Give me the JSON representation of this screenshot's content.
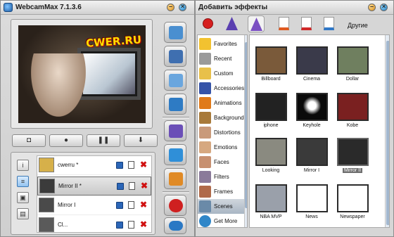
{
  "left_window": {
    "title": "WebcamMax  7.1.3.6",
    "minimize_glyph": "–",
    "close_glyph": "×"
  },
  "preview": {
    "overlay_text": "CWER.RU"
  },
  "controls": [
    {
      "icon": "camera-icon",
      "glyph": "◘"
    },
    {
      "icon": "record-icon",
      "glyph": "●"
    },
    {
      "icon": "pause-icon",
      "glyph": "❚❚"
    },
    {
      "icon": "download-icon",
      "glyph": "⬇"
    }
  ],
  "layer_side_buttons": [
    {
      "icon": "info-icon",
      "glyph": "i"
    },
    {
      "icon": "list-icon",
      "glyph": "≡"
    },
    {
      "icon": "person-icon",
      "glyph": "▣"
    },
    {
      "icon": "film-icon",
      "glyph": "▤"
    }
  ],
  "layers": [
    {
      "name": "cwerru *",
      "selected": false,
      "thumb_color": "#d6b04a"
    },
    {
      "name": "Mirror II *",
      "selected": true,
      "thumb_color": "#3b3b3b"
    },
    {
      "name": "Mirror I",
      "selected": false,
      "thumb_color": "#4a4a4a"
    },
    {
      "name": "Cl...",
      "selected": false,
      "thumb_color": "#5a5a5a"
    }
  ],
  "tools": [
    {
      "icon": "user-profile-icon",
      "color": "#4a8fd0"
    },
    {
      "icon": "video-clip-icon",
      "color": "#3f6fb0"
    },
    {
      "icon": "window-icon",
      "color": "#6aa6de"
    },
    {
      "icon": "screen-capture-icon",
      "color": "#2e7bc4"
    },
    {
      "icon": "wizard-hat-icon",
      "color": "#6b4fb7"
    },
    {
      "icon": "pencil-icon",
      "color": "#2f8fd8"
    },
    {
      "icon": "blocks-icon",
      "color": "#e08a25"
    },
    {
      "icon": "close-icon",
      "color": "#cf2020"
    },
    {
      "icon": "settings-icon",
      "color": "#2a78c4"
    }
  ],
  "right_window": {
    "title": "Добавить эффекты",
    "minimize_glyph": "–",
    "close_glyph": "×",
    "others_label": "Другие"
  },
  "category_tools": [
    {
      "icon": "remove-icon",
      "color": "#d61f1f",
      "selected": false
    },
    {
      "icon": "wizard-hat-icon",
      "color": "#5a3fb0",
      "selected": false
    },
    {
      "icon": "wizard-hat-plus-icon",
      "color": "#7a4fc2",
      "selected": true
    },
    {
      "icon": "add-image-icon",
      "color": "#e05a20",
      "selected": false
    },
    {
      "icon": "add-pdf-icon",
      "color": "#d02828",
      "selected": false
    },
    {
      "icon": "add-text-icon",
      "color": "#2f78c8",
      "selected": false
    }
  ],
  "categories": [
    {
      "label": "Favorites",
      "icon": "star-icon",
      "color": "#f2c230",
      "selected": false
    },
    {
      "label": "Recent",
      "icon": "clock-icon",
      "color": "#9a9a9a",
      "selected": false
    },
    {
      "label": "Custom",
      "icon": "folder-icon",
      "color": "#e8c04a",
      "selected": false
    },
    {
      "label": "Accessories",
      "icon": "cap-icon",
      "color": "#3553a8",
      "selected": false
    },
    {
      "label": "Animations",
      "icon": "butterfly-icon",
      "color": "#e07a1a",
      "selected": false
    },
    {
      "label": "Background",
      "icon": "landscape-icon",
      "color": "#a87a3a",
      "selected": false
    },
    {
      "label": "Distortions",
      "icon": "face-distort-icon",
      "color": "#c99a7a",
      "selected": false
    },
    {
      "label": "Emotions",
      "icon": "face-icon",
      "color": "#d6a880",
      "selected": false
    },
    {
      "label": "Faces",
      "icon": "face-mask-icon",
      "color": "#c79070",
      "selected": false
    },
    {
      "label": "Filters",
      "icon": "filter-icon",
      "color": "#8a7a9a",
      "selected": false
    },
    {
      "label": "Frames",
      "icon": "frame-icon",
      "color": "#b06a4a",
      "selected": false
    },
    {
      "label": "Scenes",
      "icon": "scene-icon",
      "color": "#6a8aa8",
      "selected": true
    },
    {
      "label": "Get More",
      "icon": "globe-icon",
      "color": "#2f86c8",
      "selected": false
    }
  ],
  "effects": [
    {
      "name": "Billboard",
      "selected": false,
      "thumb_color": "#7a5a3a"
    },
    {
      "name": "Cinema",
      "selected": false,
      "thumb_color": "#3a3a4a"
    },
    {
      "name": "Dollar",
      "selected": false,
      "thumb_color": "#6f7f5f"
    },
    {
      "name": "iphone",
      "selected": false,
      "thumb_color": "#222222"
    },
    {
      "name": "Keyhole",
      "selected": false,
      "thumb_color": "#0a0a0a"
    },
    {
      "name": "Kobe",
      "selected": false,
      "thumb_color": "#7a2020"
    },
    {
      "name": "Looking",
      "selected": false,
      "thumb_color": "#8a8a80"
    },
    {
      "name": "Mirror I",
      "selected": false,
      "thumb_color": "#3a3a3a"
    },
    {
      "name": "Mirror II",
      "selected": true,
      "thumb_color": "#2a2a2a"
    },
    {
      "name": "NBA MVP",
      "selected": false,
      "thumb_color": "#9aa0aa"
    },
    {
      "name": "News",
      "selected": false,
      "thumb_color": "#ffffff"
    },
    {
      "name": "Newspaper",
      "selected": false,
      "thumb_color": "#ffffff"
    }
  ]
}
